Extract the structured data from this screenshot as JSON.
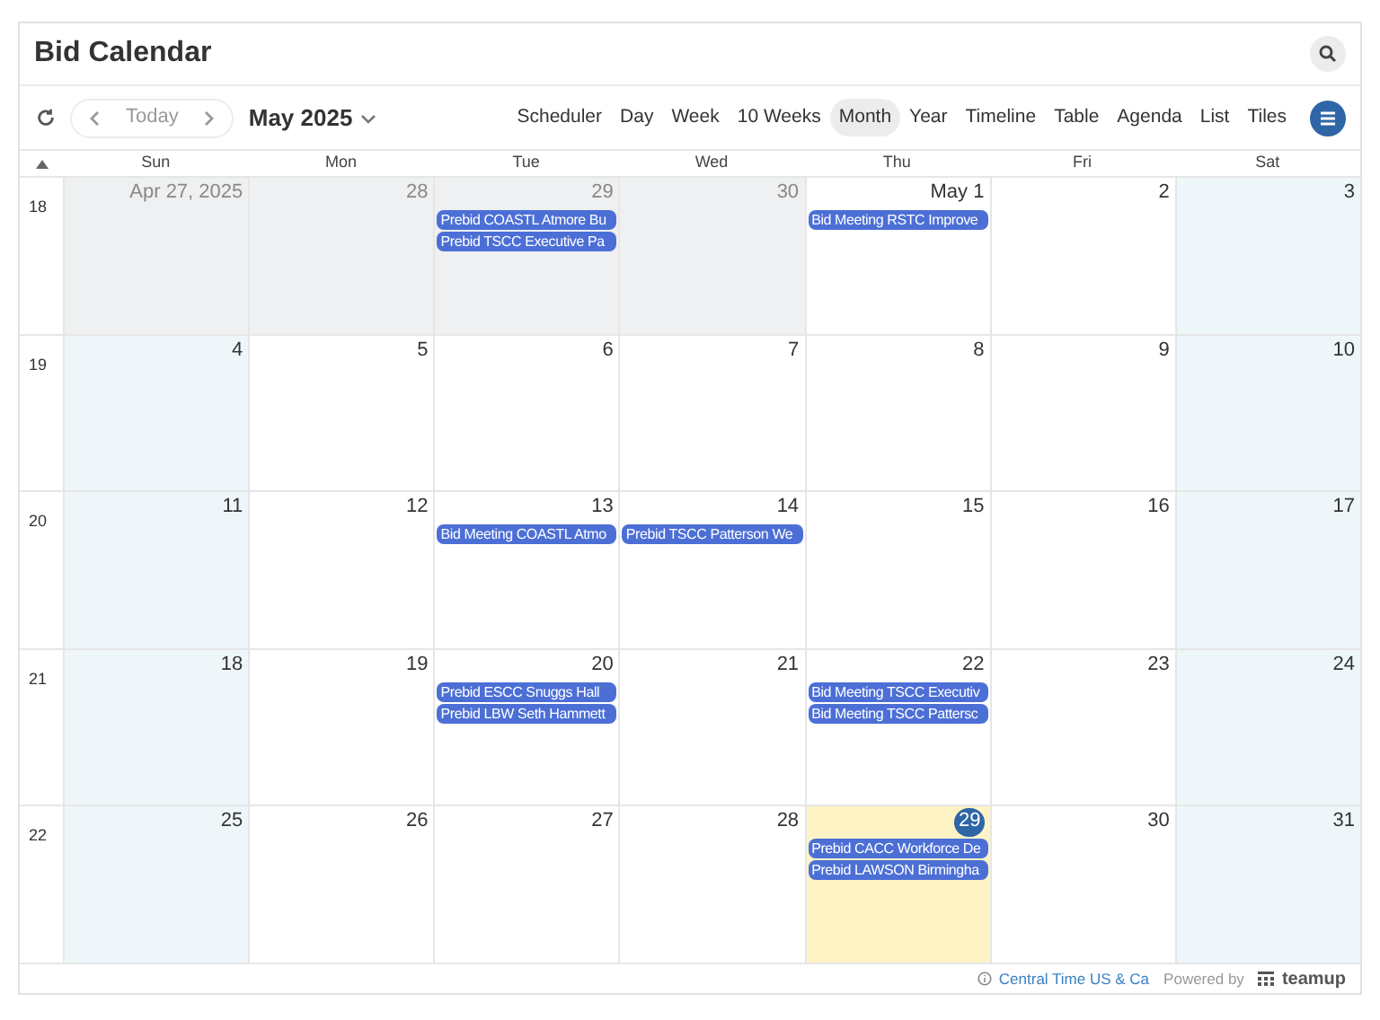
{
  "title": "Bid Calendar",
  "toolbar": {
    "today": "Today",
    "month_label": "May 2025",
    "views": [
      {
        "label": "Scheduler",
        "selected": false
      },
      {
        "label": "Day",
        "selected": false
      },
      {
        "label": "Week",
        "selected": false
      },
      {
        "label": "10 Weeks",
        "selected": false
      },
      {
        "label": "Month",
        "selected": true
      },
      {
        "label": "Year",
        "selected": false
      },
      {
        "label": "Timeline",
        "selected": false
      },
      {
        "label": "Table",
        "selected": false
      },
      {
        "label": "Agenda",
        "selected": false
      },
      {
        "label": "List",
        "selected": false
      },
      {
        "label": "Tiles",
        "selected": false
      }
    ]
  },
  "weekdays": [
    "Sun",
    "Mon",
    "Tue",
    "Wed",
    "Thu",
    "Fri",
    "Sat"
  ],
  "weeks": [
    {
      "number": "18",
      "days": [
        {
          "date": "Apr 27, 2025",
          "other_month": true,
          "today": false
        },
        {
          "date": "28",
          "other_month": true,
          "today": false
        },
        {
          "date": "29",
          "other_month": true,
          "today": false,
          "events": [
            "Prebid COASTL Atmore Bu",
            "Prebid TSCC Executive Pa"
          ]
        },
        {
          "date": "30",
          "other_month": true,
          "today": false
        },
        {
          "date": "May 1",
          "other_month": false,
          "today": false,
          "events": [
            "Bid Meeting RSTC Improve"
          ]
        },
        {
          "date": "2",
          "other_month": false,
          "today": false
        },
        {
          "date": "3",
          "other_month": false,
          "today": false
        }
      ]
    },
    {
      "number": "19",
      "days": [
        {
          "date": "4",
          "other_month": false,
          "today": false
        },
        {
          "date": "5",
          "other_month": false,
          "today": false
        },
        {
          "date": "6",
          "other_month": false,
          "today": false
        },
        {
          "date": "7",
          "other_month": false,
          "today": false
        },
        {
          "date": "8",
          "other_month": false,
          "today": false
        },
        {
          "date": "9",
          "other_month": false,
          "today": false
        },
        {
          "date": "10",
          "other_month": false,
          "today": false
        }
      ]
    },
    {
      "number": "20",
      "days": [
        {
          "date": "11",
          "other_month": false,
          "today": false
        },
        {
          "date": "12",
          "other_month": false,
          "today": false
        },
        {
          "date": "13",
          "other_month": false,
          "today": false,
          "events": [
            "Bid Meeting COASTL Atmo"
          ]
        },
        {
          "date": "14",
          "other_month": false,
          "today": false,
          "events": [
            "Prebid TSCC Patterson We"
          ]
        },
        {
          "date": "15",
          "other_month": false,
          "today": false
        },
        {
          "date": "16",
          "other_month": false,
          "today": false
        },
        {
          "date": "17",
          "other_month": false,
          "today": false
        }
      ]
    },
    {
      "number": "21",
      "days": [
        {
          "date": "18",
          "other_month": false,
          "today": false
        },
        {
          "date": "19",
          "other_month": false,
          "today": false
        },
        {
          "date": "20",
          "other_month": false,
          "today": false,
          "events": [
            "Prebid ESCC Snuggs Hall",
            "Prebid LBW Seth Hammett"
          ]
        },
        {
          "date": "21",
          "other_month": false,
          "today": false
        },
        {
          "date": "22",
          "other_month": false,
          "today": false,
          "events": [
            "Bid Meeting TSCC Executiv",
            "Bid Meeting TSCC Pattersc"
          ]
        },
        {
          "date": "23",
          "other_month": false,
          "today": false
        },
        {
          "date": "24",
          "other_month": false,
          "today": false
        }
      ]
    },
    {
      "number": "22",
      "days": [
        {
          "date": "25",
          "other_month": false,
          "today": false
        },
        {
          "date": "26",
          "other_month": false,
          "today": false
        },
        {
          "date": "27",
          "other_month": false,
          "today": false
        },
        {
          "date": "28",
          "other_month": false,
          "today": false
        },
        {
          "date": "29",
          "other_month": false,
          "today": true,
          "events": [
            "Prebid CACC Workforce De",
            "Prebid LAWSON Birmingha"
          ]
        },
        {
          "date": "30",
          "other_month": false,
          "today": false
        },
        {
          "date": "31",
          "other_month": false,
          "today": false
        }
      ]
    }
  ],
  "footer": {
    "timezone": "Central Time US & Ca",
    "powered_by": "Powered by",
    "brand": "teamup"
  }
}
